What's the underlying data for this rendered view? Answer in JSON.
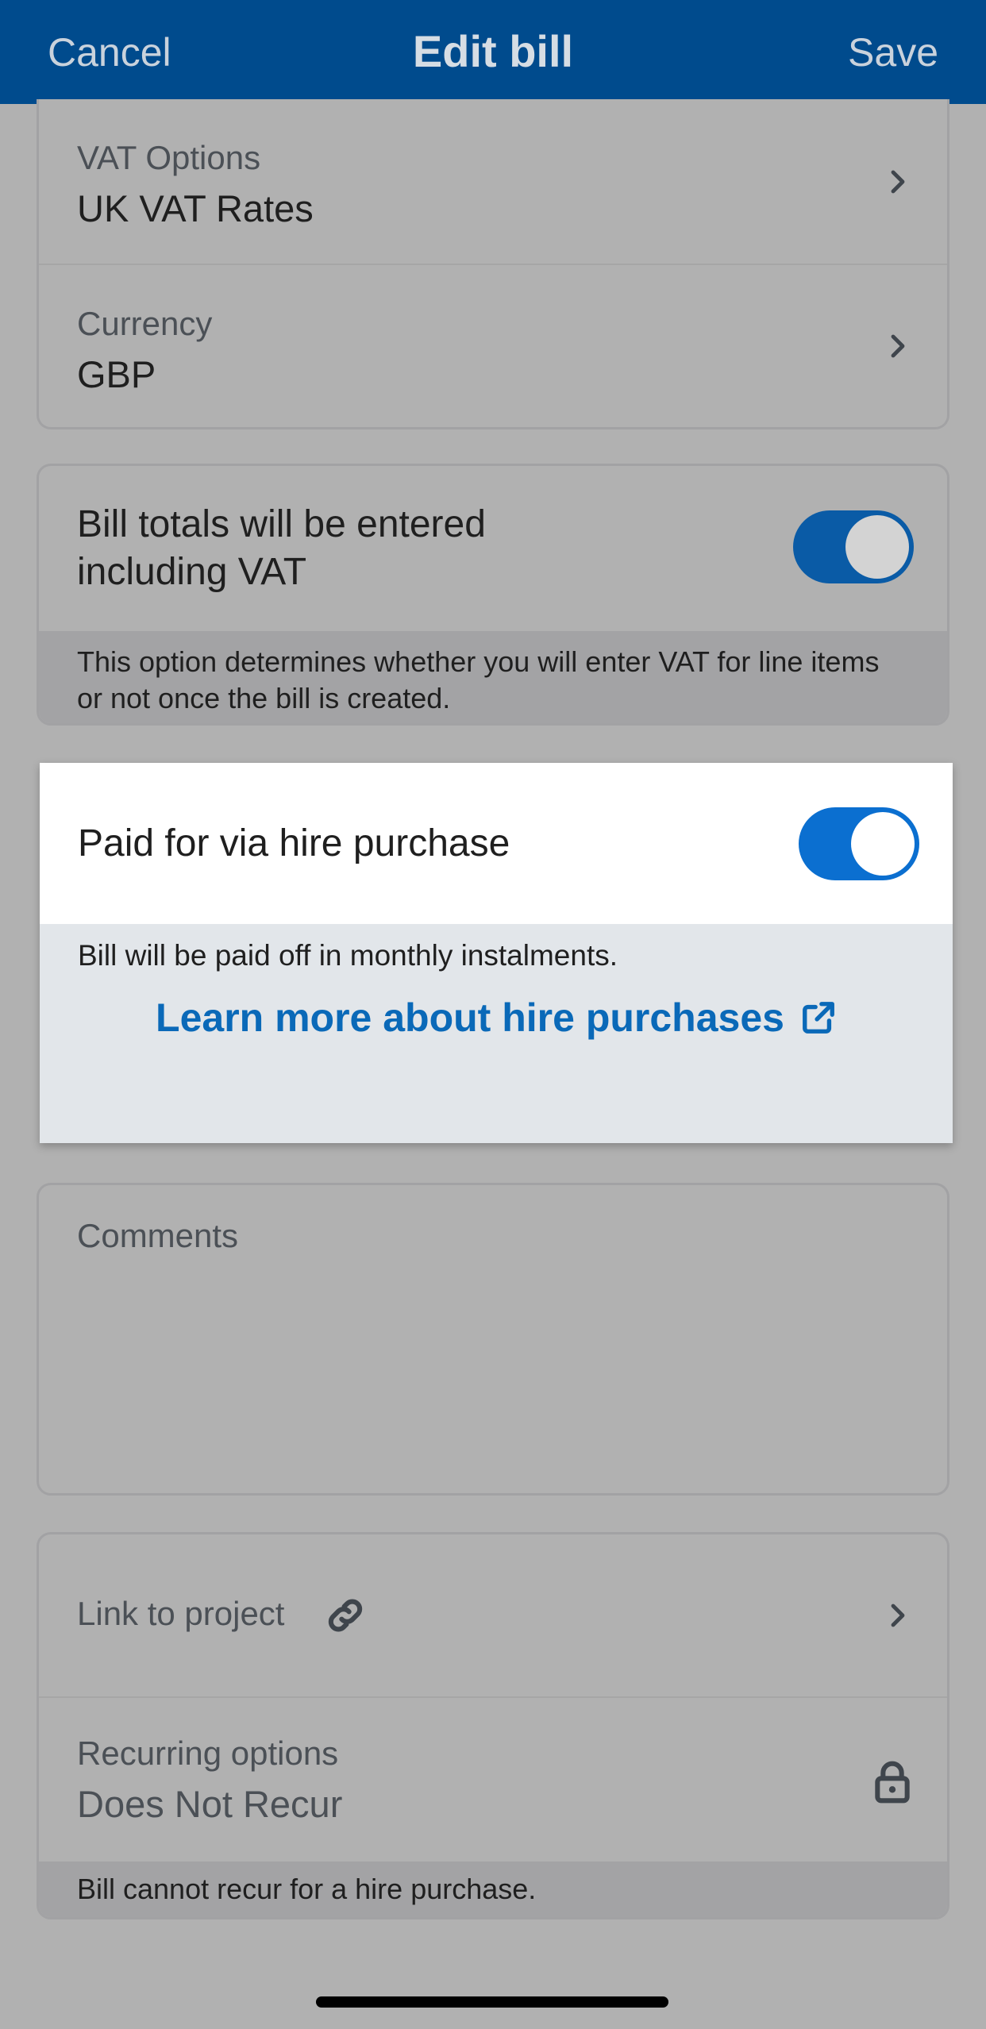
{
  "header": {
    "cancel": "Cancel",
    "title": "Edit bill",
    "save": "Save"
  },
  "vat_options": {
    "label": "VAT Options",
    "value": "UK VAT Rates"
  },
  "currency": {
    "label": "Currency",
    "value": "GBP"
  },
  "totals_incl_vat": {
    "text": "Bill totals will be entered including VAT",
    "enabled": true,
    "note": "This option determines whether you will enter VAT for line items or not once the bill is created."
  },
  "hire_purchase": {
    "text": "Paid for via hire purchase",
    "enabled": true,
    "note": "Bill will be paid off in monthly instalments.",
    "link": "Learn more about hire purchases"
  },
  "comments": {
    "placeholder": "Comments"
  },
  "link_project": {
    "label": "Link to project"
  },
  "recurring": {
    "label": "Recurring options",
    "value": "Does Not Recur",
    "note": "Bill cannot recur for a hire purchase."
  },
  "colors": {
    "header": "#004b8d",
    "accent": "#0a69b8",
    "overlay": "#b1b1b1"
  }
}
